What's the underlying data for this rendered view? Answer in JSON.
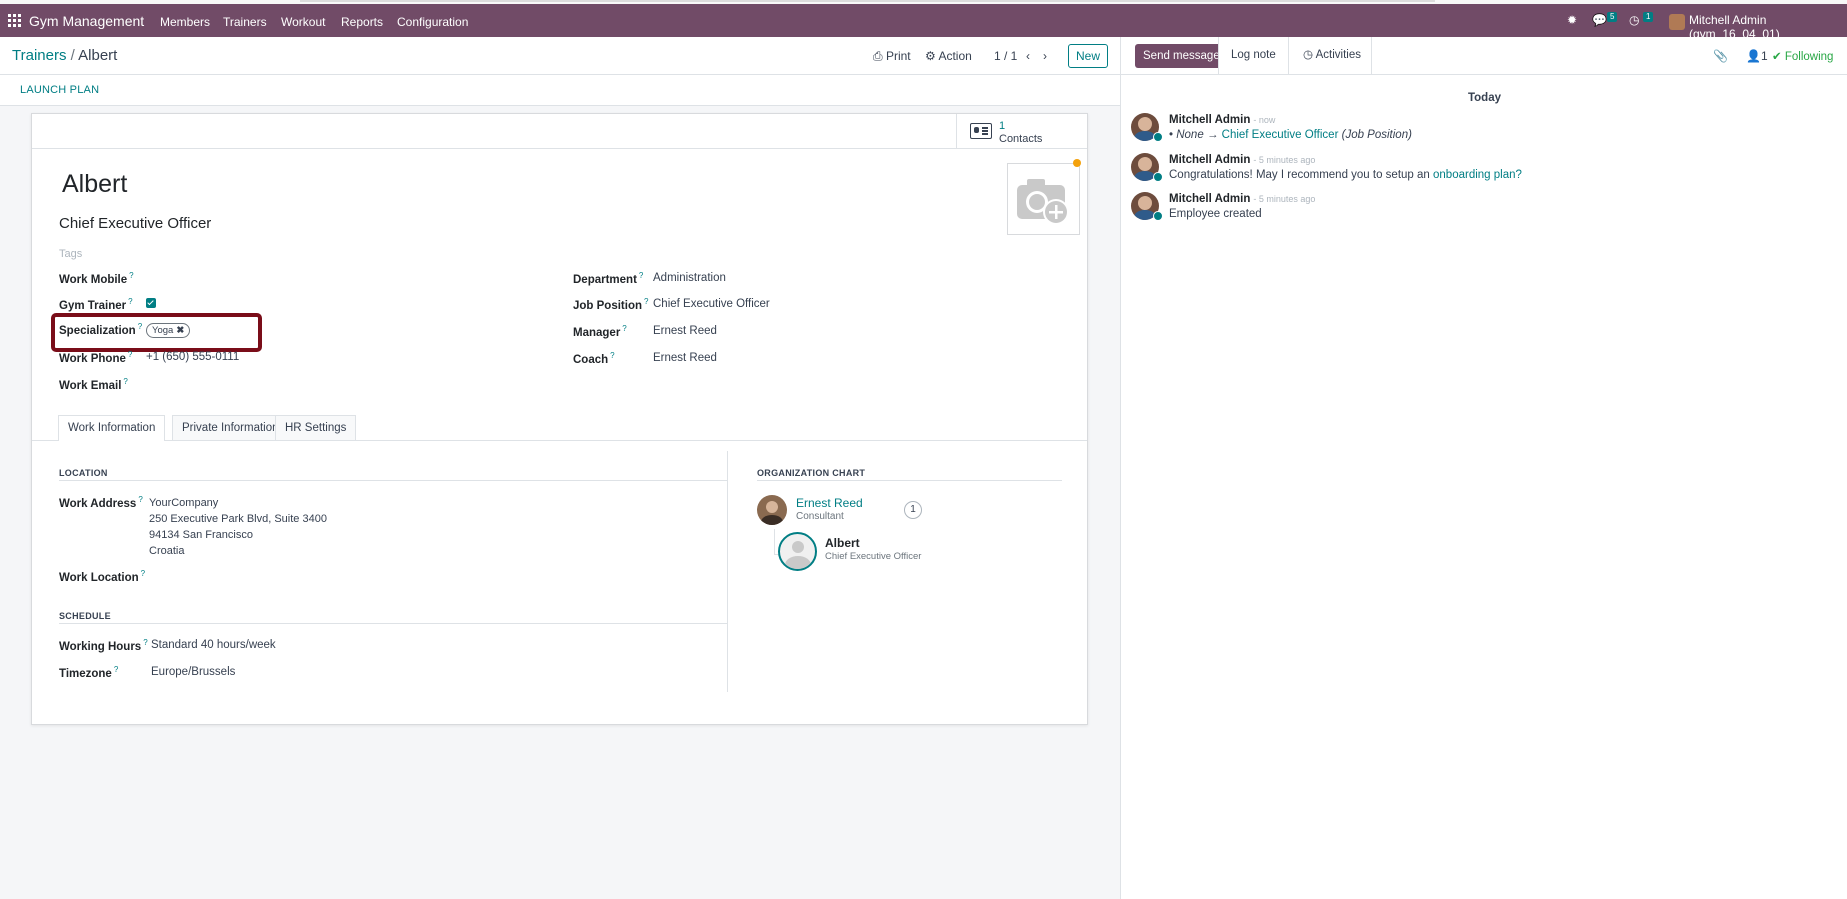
{
  "navbar": {
    "app_name": "Gym Management",
    "menu": [
      "Members",
      "Trainers",
      "Workout",
      "Reports",
      "Configuration"
    ],
    "messages_badge": "5",
    "activities_badge": "1",
    "user": "Mitchell Admin (gym_16_04_01)"
  },
  "breadcrumb": {
    "parent": "Trainers",
    "separator": "/",
    "current": "Albert"
  },
  "control": {
    "print": "Print",
    "action": "Action",
    "pager": "1 / 1",
    "new": "New"
  },
  "statusbar": {
    "launch_plan": "LAUNCH PLAN"
  },
  "smart_button": {
    "count": "1",
    "label": "Contacts"
  },
  "employee": {
    "name": "Albert",
    "job_title": "Chief Executive Officer",
    "tags_placeholder": "Tags"
  },
  "fields_left": {
    "work_mobile_label": "Work Mobile",
    "gym_trainer_label": "Gym Trainer",
    "specialization_label": "Specialization",
    "specialization_tag": "Yoga",
    "work_phone_label": "Work Phone",
    "work_phone_value": "+1 (650) 555-0111",
    "work_email_label": "Work Email"
  },
  "fields_right": {
    "department_label": "Department",
    "department_value": "Administration",
    "job_position_label": "Job Position",
    "job_position_value": "Chief Executive Officer",
    "manager_label": "Manager",
    "manager_value": "Ernest Reed",
    "coach_label": "Coach",
    "coach_value": "Ernest Reed"
  },
  "tabs": [
    "Work Information",
    "Private Information",
    "HR Settings"
  ],
  "work_info": {
    "location_header": "LOCATION",
    "work_address_label": "Work Address",
    "address_lines": [
      "YourCompany",
      "250 Executive Park Blvd, Suite 3400",
      "94134 San Francisco",
      "Croatia"
    ],
    "work_location_label": "Work Location",
    "schedule_header": "SCHEDULE",
    "working_hours_label": "Working Hours",
    "working_hours_value": "Standard 40 hours/week",
    "timezone_label": "Timezone",
    "timezone_value": "Europe/Brussels"
  },
  "org_chart": {
    "header": "ORGANIZATION CHART",
    "manager_name": "Ernest Reed",
    "manager_title": "Consultant",
    "subordinates": "1",
    "self_name": "Albert",
    "self_title": "Chief Executive Officer"
  },
  "chatter": {
    "send_message": "Send message",
    "log_note": "Log note",
    "activities": "Activities",
    "followers": "1",
    "following": "Following",
    "today": "Today",
    "messages": [
      {
        "author": "Mitchell Admin",
        "time": "- now",
        "none": "None",
        "arrow": "→",
        "new_value": "Chief Executive Officer",
        "field": "(Job Position)"
      },
      {
        "author": "Mitchell Admin",
        "time": "- 5 minutes ago",
        "text": "Congratulations! May I recommend you to setup an",
        "link": "onboarding plan?"
      },
      {
        "author": "Mitchell Admin",
        "time": "- 5 minutes ago",
        "text": "Employee created"
      }
    ]
  },
  "colors": {
    "brand": "#714b67",
    "accent": "#017e84",
    "highlight": "#7a0d19",
    "following": "#28a745"
  }
}
